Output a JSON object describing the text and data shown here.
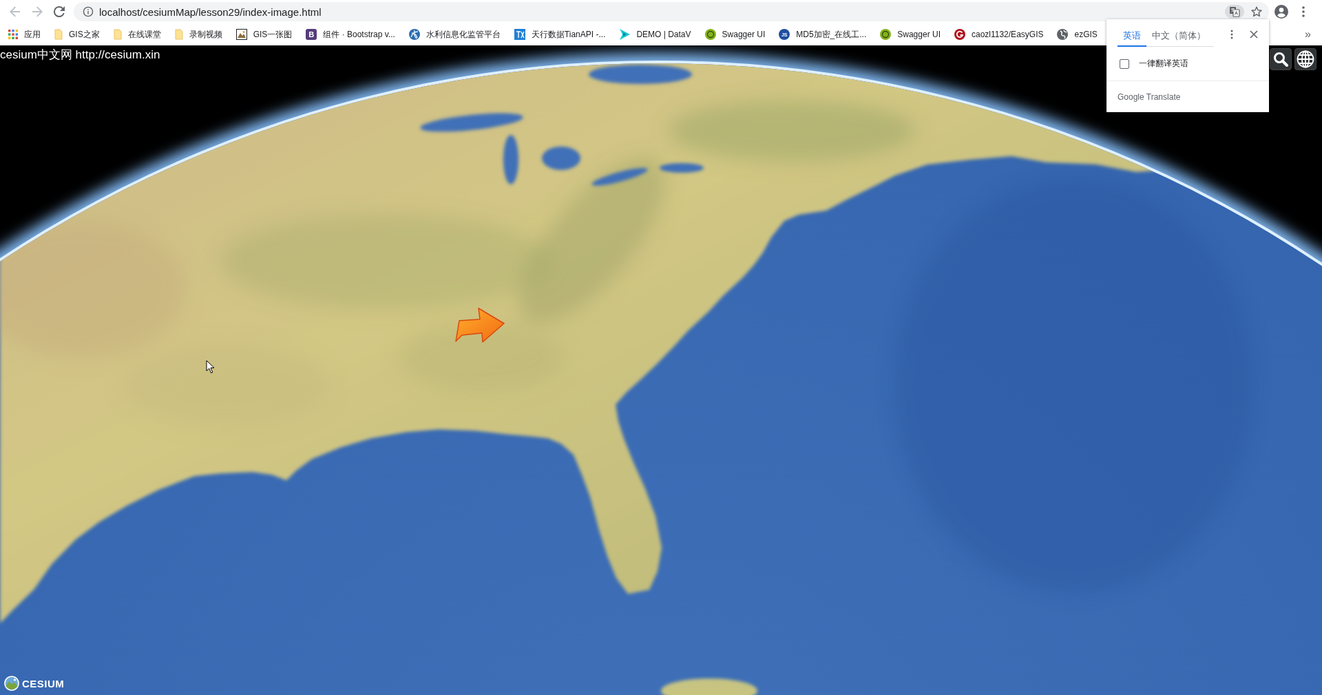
{
  "browser": {
    "address_bar": {
      "url": "localhost/cesiumMap/lesson29/index-image.html"
    },
    "bookmarks": [
      {
        "kind": "apps",
        "label": "应用"
      },
      {
        "kind": "folder",
        "label": "GIS之家"
      },
      {
        "kind": "folder",
        "label": "在线课堂"
      },
      {
        "kind": "folder",
        "label": "录制视频"
      },
      {
        "kind": "picture",
        "label": "GIS一张图"
      },
      {
        "kind": "letter",
        "label": "组件 · Bootstrap v...",
        "icon_text": "B",
        "color": "#563d7c"
      },
      {
        "kind": "swirl",
        "label": "水利信息化监管平台",
        "color": "#2b6cb0"
      },
      {
        "kind": "tile",
        "label": "天行数据TianAPI -...",
        "color": "#1f7fd6"
      },
      {
        "kind": "play",
        "label": "DEMO | DataV",
        "color": "#1fc8d6"
      },
      {
        "kind": "dot",
        "label": "Swagger UI",
        "color": "#85b11c"
      },
      {
        "kind": "letter",
        "label": "MD5加密_在线工...",
        "icon_text": "JS",
        "color": "#1f4fa0"
      },
      {
        "kind": "dot",
        "label": "Swagger UI",
        "color": "#85b11c"
      },
      {
        "kind": "ring",
        "label": "caozl1132/EasyGIS",
        "color": "#b0121b"
      },
      {
        "kind": "globe",
        "label": "ezGIS",
        "color": "#5f6368"
      }
    ],
    "bookmarks_overflow": "»"
  },
  "translate_popup": {
    "tabs": [
      {
        "label": "英语",
        "selected": true
      },
      {
        "label": "中文（简体）",
        "selected": false
      }
    ],
    "always_translate": {
      "label": "一律翻译英语",
      "checked": false
    },
    "footer": "Google Translate"
  },
  "viewer": {
    "title": "cesium中文网 http://cesium.xin",
    "logo": "CESIUM"
  }
}
